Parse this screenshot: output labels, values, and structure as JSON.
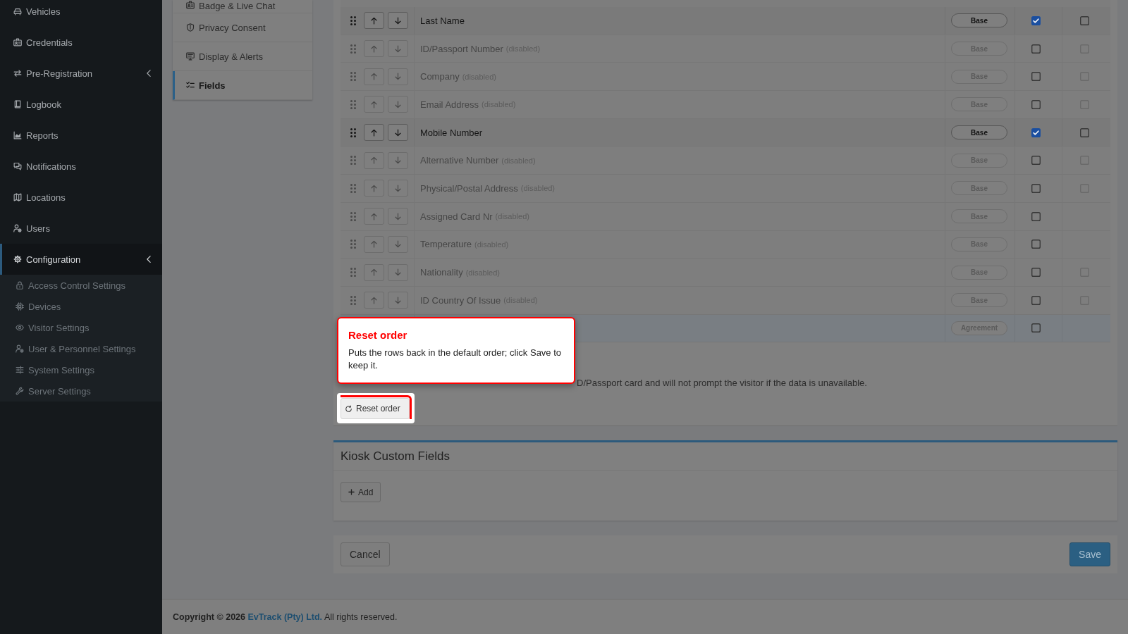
{
  "sidebar": {
    "items": [
      {
        "label": "Vehicles",
        "selected": false,
        "has_submenu": false
      },
      {
        "label": "Credentials",
        "selected": false,
        "has_submenu": false
      },
      {
        "label": "Pre-Registration",
        "selected": false,
        "has_submenu": true
      },
      {
        "label": "Logbook",
        "selected": false,
        "has_submenu": false
      },
      {
        "label": "Reports",
        "selected": false,
        "has_submenu": false
      },
      {
        "label": "Notifications",
        "selected": false,
        "has_submenu": false
      },
      {
        "label": "Locations",
        "selected": false,
        "has_submenu": false
      },
      {
        "label": "Users",
        "selected": false,
        "has_submenu": false
      },
      {
        "label": "Configuration",
        "selected": true,
        "has_submenu": true,
        "children": [
          {
            "label": "Access Control Settings",
            "selected": false
          },
          {
            "label": "Devices",
            "selected": false
          },
          {
            "label": "Visitor Settings",
            "selected": false
          },
          {
            "label": "User & Personnel Settings",
            "selected": false
          },
          {
            "label": "System Settings",
            "selected": false
          },
          {
            "label": "Server Settings",
            "selected": false
          }
        ]
      }
    ]
  },
  "settings_nav": {
    "items": [
      {
        "label": "Badge & Live Chat",
        "selected": false
      },
      {
        "label": "Privacy Consent",
        "selected": false
      },
      {
        "label": "Display & Alerts",
        "selected": false
      },
      {
        "label": "Fields",
        "selected": true
      }
    ]
  },
  "fields_table": {
    "rows": [
      {
        "kind": "field",
        "name": "Last Name",
        "disabled": false,
        "badge": "Base",
        "checks": [
          {
            "checked": true,
            "disabled": false
          },
          {
            "checked": false,
            "disabled": false
          }
        ]
      },
      {
        "kind": "field",
        "name": "ID/Passport Number",
        "note": "(disabled)",
        "disabled": true,
        "badge": "Base",
        "checks": [
          {
            "checked": false,
            "disabled": false
          },
          {
            "checked": false,
            "disabled": true
          }
        ]
      },
      {
        "kind": "field",
        "name": "Company",
        "note": "(disabled)",
        "disabled": true,
        "badge": "Base",
        "checks": [
          {
            "checked": false,
            "disabled": false
          },
          {
            "checked": false,
            "disabled": true
          }
        ]
      },
      {
        "kind": "field",
        "name": "Email Address",
        "note": "(disabled)",
        "disabled": true,
        "badge": "Base",
        "checks": [
          {
            "checked": false,
            "disabled": false
          },
          {
            "checked": false,
            "disabled": true
          }
        ]
      },
      {
        "kind": "field",
        "name": "Mobile Number",
        "disabled": false,
        "badge": "Base",
        "checks": [
          {
            "checked": true,
            "disabled": false
          },
          {
            "checked": false,
            "disabled": false
          }
        ]
      },
      {
        "kind": "field",
        "name": "Alternative Number",
        "note": "(disabled)",
        "disabled": true,
        "badge": "Base",
        "checks": [
          {
            "checked": false,
            "disabled": false
          },
          {
            "checked": false,
            "disabled": true
          }
        ]
      },
      {
        "kind": "field",
        "name": "Physical/Postal Address",
        "note": "(disabled)",
        "disabled": true,
        "badge": "Base",
        "checks": [
          {
            "checked": false,
            "disabled": false
          },
          {
            "checked": false,
            "disabled": true
          }
        ]
      },
      {
        "kind": "field",
        "name": "Assigned Card Nr",
        "note": "(disabled)",
        "disabled": true,
        "badge": "Base",
        "checks": [
          {
            "checked": false,
            "disabled": false
          }
        ]
      },
      {
        "kind": "field",
        "name": "Temperature",
        "note": "(disabled)",
        "disabled": true,
        "badge": "Base",
        "checks": [
          {
            "checked": false,
            "disabled": false
          }
        ]
      },
      {
        "kind": "field",
        "name": "Nationality",
        "note": "(disabled)",
        "disabled": true,
        "badge": "Base",
        "checks": [
          {
            "checked": false,
            "disabled": false
          },
          {
            "checked": false,
            "disabled": true
          }
        ]
      },
      {
        "kind": "field",
        "name": "ID Country Of Issue",
        "note": "(disabled)",
        "disabled": true,
        "badge": "Base",
        "checks": [
          {
            "checked": false,
            "disabled": false
          },
          {
            "checked": false,
            "disabled": true
          }
        ]
      },
      {
        "kind": "agreement",
        "disabled": true,
        "badge": "Agreement",
        "checks": [
          {
            "checked": false,
            "disabled": false
          }
        ]
      }
    ]
  },
  "note": "D/Passport card and will not prompt the visitor if the data is unavailable.",
  "reset_button": "Reset order",
  "tour_tooltip": {
    "title": "Reset order",
    "text": "Puts the rows back in the default order; click Save to keep it."
  },
  "kiosk_custom_fields": {
    "title": "Kiosk Custom Fields",
    "add_button": "Add"
  },
  "actions": {
    "cancel": "Cancel",
    "save": "Save"
  },
  "footer": {
    "copyright": "Copyright © 2026",
    "company": "EvTrack (Pty) Ltd.",
    "rights": "All rights reserved."
  }
}
